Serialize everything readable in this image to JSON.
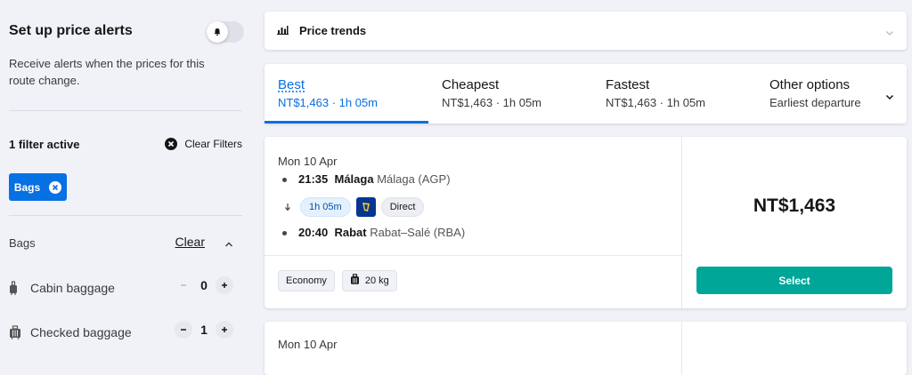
{
  "sidebar": {
    "alerts": {
      "title": "Set up price alerts",
      "description": "Receive alerts when the prices for this route change."
    },
    "filters": {
      "active_label": "1 filter active",
      "clear_filters_label": "Clear Filters",
      "chips": [
        {
          "label": "Bags"
        }
      ]
    },
    "bags": {
      "heading": "Bags",
      "clear_label": "Clear",
      "rows": [
        {
          "label": "Cabin baggage",
          "value": "0",
          "icon": "cabin-bag-icon"
        },
        {
          "label": "Checked baggage",
          "value": "1",
          "icon": "checked-bag-icon"
        }
      ]
    }
  },
  "price_trends": {
    "label": "Price trends",
    "icon": "bar-chart-icon"
  },
  "sort_tabs": [
    {
      "title": "Best",
      "sub": "NT$1,463 · 1h 05m",
      "active": true
    },
    {
      "title": "Cheapest",
      "sub": "NT$1,463 · 1h 05m"
    },
    {
      "title": "Fastest",
      "sub": "NT$1,463 · 1h 05m"
    },
    {
      "title": "Other options",
      "sub": "Earliest departure"
    }
  ],
  "results": [
    {
      "date": "Mon 10 Apr",
      "depart_time": "21:35",
      "depart_city": "Málaga",
      "depart_airport": "Málaga (AGP)",
      "duration": "1h 05m",
      "stops": "Direct",
      "airline_logo": "ryanair-harp-logo",
      "arrive_time": "20:40",
      "arrive_city": "Rabat",
      "arrive_airport": "Rabat–Salé (RBA)",
      "cabin": "Economy",
      "baggage": "20 kg",
      "price": "NT$1,463",
      "select_label": "Select"
    },
    {
      "date": "Mon 10 Apr"
    }
  ],
  "colors": {
    "accent": "#0770e3",
    "select_button": "#00a698",
    "background": "#f1f2f8"
  }
}
